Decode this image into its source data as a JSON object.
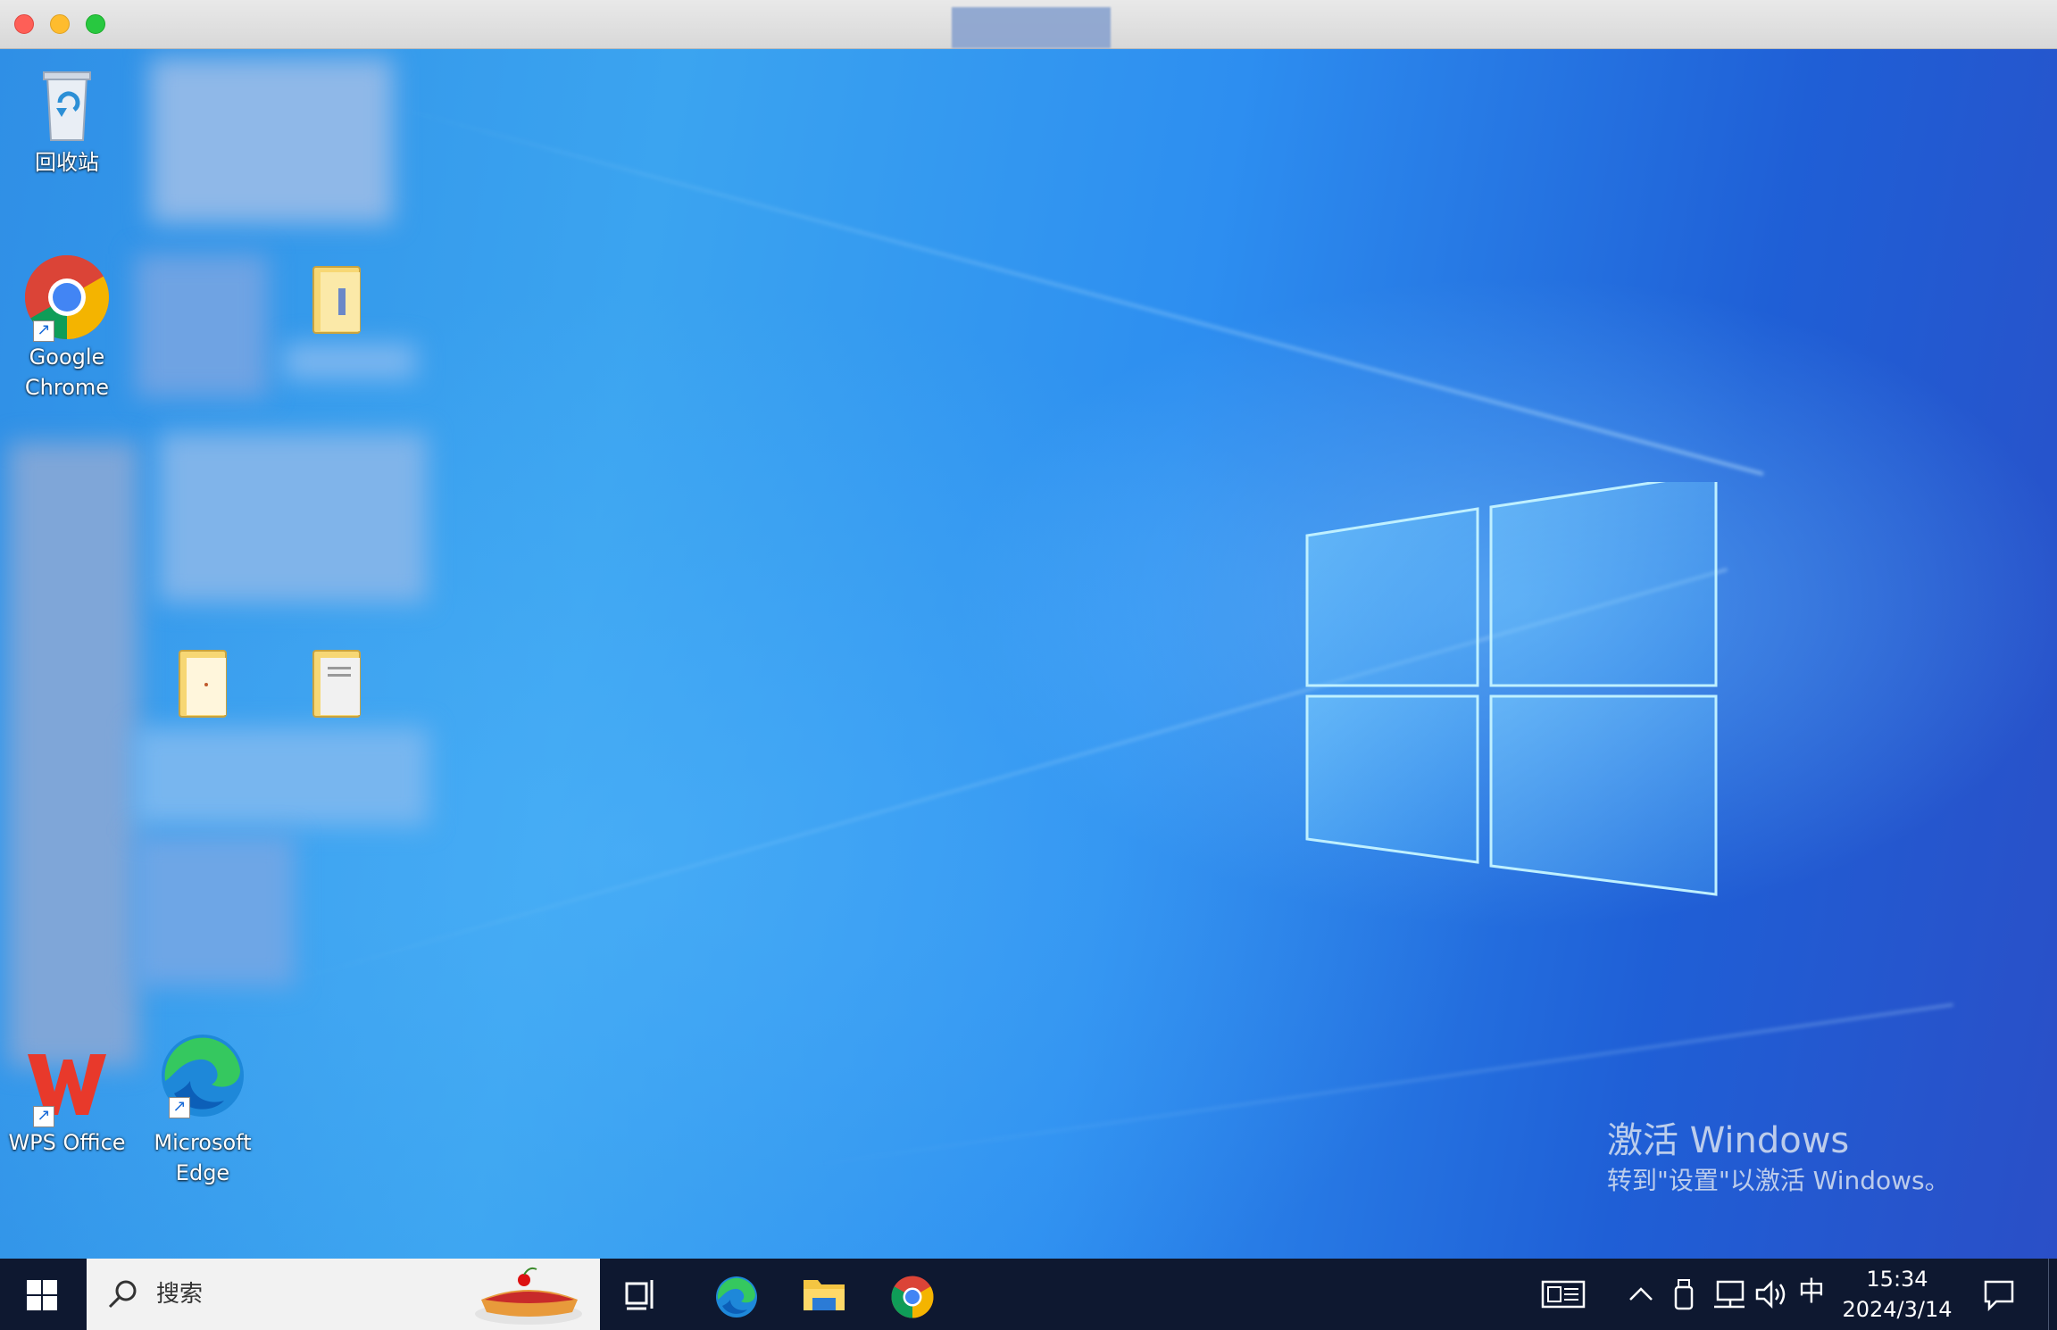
{
  "desktop": {
    "icons": [
      {
        "name": "回收站"
      },
      {
        "name": "Google Chrome"
      },
      {
        "name": "WPS Office"
      },
      {
        "name": "Microsoft Edge"
      }
    ],
    "activation": {
      "title": "激活 Windows",
      "subtitle": "转到\"设置\"以激活 Windows。"
    }
  },
  "taskbar": {
    "search_placeholder": "搜索",
    "ime_label": "中",
    "time": "15:34",
    "date": "2024/3/14"
  },
  "colors": {
    "taskbar": "#0e1830",
    "search_bg": "#f2f2f2",
    "desktop_accent": "#2f8fe6"
  }
}
